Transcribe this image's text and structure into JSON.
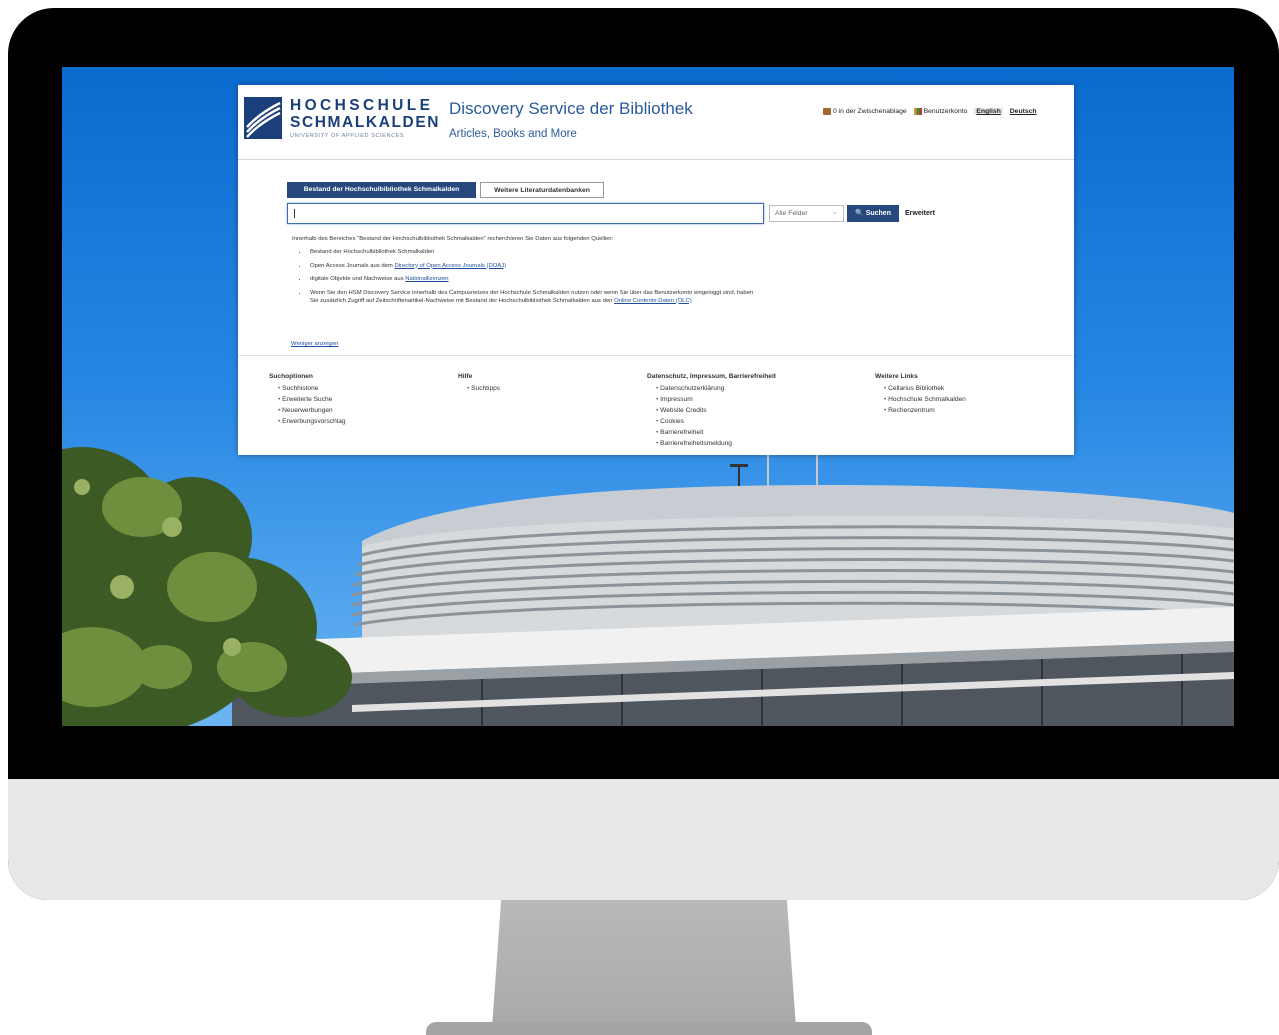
{
  "header": {
    "logo": {
      "line1": "HOCHSCHULE",
      "line2": "SCHMALKALDEN",
      "line3": "UNIVERSITY OF APPLIED SCIENCES"
    },
    "title": "Discovery Service der Bibliothek",
    "subtitle": "Articles, Books and More",
    "topnav": {
      "basket": "0 in der Zwischenablage",
      "account": "Benutzerkonto",
      "lang_en": "English",
      "lang_de": "Deutsch"
    }
  },
  "search": {
    "tabs": [
      {
        "label": "Bestand der Hochschulbibliothek Schmalkalden",
        "active": true
      },
      {
        "label": "Weitere Literaturdatenbanken",
        "active": false
      }
    ],
    "input_value": "",
    "field_select": "Alle Felder",
    "submit_label": "Suchen",
    "advanced_label": "Erweitert"
  },
  "info": {
    "intro": "Innerhalb des Bereiches \"Bestand der Hochschulbibliothek Schmalkalden\" recherchieren Sie Daten aus folgenden Quellen:",
    "item1": "Bestand der Hochschulbibliothek Schmalkalden",
    "item2_prefix": "Open Access Journals aus dem ",
    "item2_link": "Directory of Open Access Journals (DOAJ)",
    "item3_prefix": "digitale Objekte und Nachweise aus ",
    "item3_link": "Nationallizenzen",
    "item4_text": "Wenn Sie den HSM Discovery Service innerhalb des Campusnetzes der Hochschule Schmalkalden nutzen oder wenn Sie über das Benutzerkonto eingeloggt sind, haben Sie zusätzlich Zugriff auf Zeitschriftenartikel-Nachweise mit Bestand der Hochschulbibliothek Schmalkalden aus den ",
    "item4_link": "Online Contents-Daten (OLC)",
    "less_link": "Weniger anzeigen"
  },
  "footer": {
    "col1": {
      "title": "Suchoptionen",
      "items": [
        "Suchhistorie",
        "Erweiterte Suche",
        "Neuerwerbungen",
        "Erwerbungsvorschlag"
      ]
    },
    "col2": {
      "title": "Hilfe",
      "items": [
        "Suchtipps"
      ]
    },
    "col3": {
      "title": "Datenschutz, Impressum, Barrierefreiheit",
      "items": [
        "Datenschutzerklärung",
        "Impressum",
        "Website Credits",
        "Cookies",
        "Barrierefreiheit",
        "Barrierefreiheitsmeldung"
      ]
    },
    "col4": {
      "title": "Weitere Links",
      "items": [
        "Cellarius Bibliothek",
        "Hochschule Schmalkalden",
        "Rechenzentrum"
      ]
    }
  },
  "colors": {
    "brand_navy": "#27487c",
    "title_blue": "#2a5a9b",
    "sky_blue": "#1a7ad9"
  }
}
